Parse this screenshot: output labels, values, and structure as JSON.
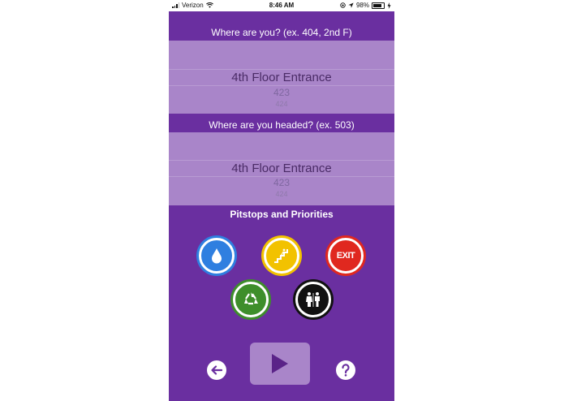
{
  "status_bar": {
    "carrier": "Verizon",
    "time": "8:46 AM",
    "battery": "98%"
  },
  "origin": {
    "prompt": "Where are you? (ex. 404, 2nd F)",
    "selected": "4th Floor Entrance",
    "next_1": "423",
    "next_2": "424"
  },
  "destination": {
    "prompt": "Where are you headed? (ex. 503)",
    "selected": "4th Floor Entrance",
    "next_1": "423",
    "next_2": "424"
  },
  "pitstops": {
    "heading": "Pitstops and Priorities",
    "items": [
      {
        "icon": "water-drop-icon",
        "ring_color": "#2f7fe0"
      },
      {
        "icon": "stairs-icon",
        "ring_color": "#f2c200"
      },
      {
        "icon": "exit-sign-icon",
        "ring_color": "#e0281f",
        "label": "EXIT"
      },
      {
        "icon": "recycle-icon",
        "ring_color": "#3e8e2b"
      },
      {
        "icon": "restroom-icon",
        "ring_color": "#111111"
      }
    ]
  },
  "colors": {
    "background": "#6a2fa0",
    "picker": "#a985c9"
  }
}
